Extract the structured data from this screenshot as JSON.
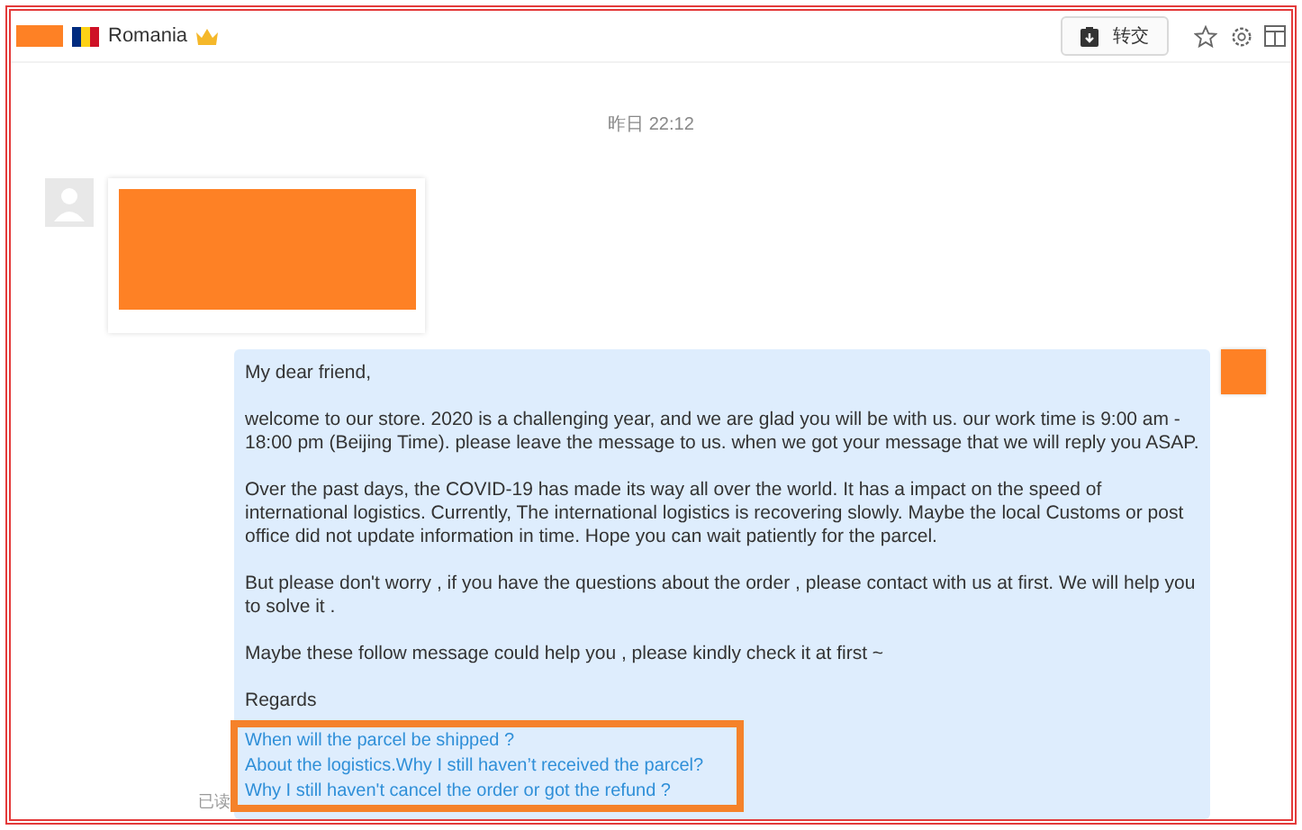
{
  "header": {
    "country": "Romania",
    "transfer_button": "转交"
  },
  "timestamp": "昨日 22:12",
  "sent_message": {
    "paragraphs": [
      "My dear friend,",
      "welcome to our store. 2020 is a challenging year, and we are glad you will be with us. our work time is 9:00 am - 18:00 pm (Beijing Time). please leave the message to us. when we got your message that we will reply you ASAP.",
      "Over the past days, the COVID-19 has made its way all over the world. It has a impact on the speed of international logistics. Currently, The international logistics is recovering slowly. Maybe the local Customs or post office did not update information in time. Hope you can wait patiently for the parcel.",
      "But please don't worry , if you have the questions about the order , please contact with us at first. We will help you to solve it .",
      "Maybe these follow message could help you , please kindly check it at first ~",
      "Regards"
    ],
    "links": [
      "When will the parcel be shipped ?",
      "About the logistics.Why I still haven’t received the parcel?",
      "Why I still haven't cancel the order or got the refund ?"
    ],
    "read_status": "已读"
  }
}
